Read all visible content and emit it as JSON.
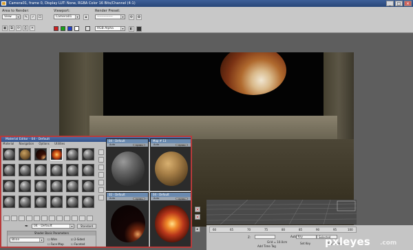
{
  "window": {
    "title": "Camera01, frame 0, Display LUT: None, RGBA Color 16 Bits/Channel (4:1)",
    "minimize": "_",
    "maximize": "□",
    "close": "×"
  },
  "toolbar": {
    "area_label": "Area to Render:",
    "area_value": "View",
    "viewport_label": "Viewport:",
    "viewport_value": "Camera01",
    "preset_label": "Render Preset:",
    "preset_value": "--------------",
    "channel_value": "RGB Alpha",
    "colors": {
      "red": "#cc2020",
      "green": "#18a018",
      "blue": "#2040c8"
    }
  },
  "material_editor": {
    "title": "Material Editor - 04 - Default",
    "menu": [
      "Material",
      "Navigation",
      "Options",
      "Utilities"
    ],
    "material_name": "04 - Default",
    "material_type": "Standard",
    "rollout_title": "Shader Basic Parameters",
    "shader_value": "Blinn",
    "checkboxes": [
      {
        "label": "Wire",
        "checked": false
      },
      {
        "label": "2-Sided",
        "checked": true
      },
      {
        "label": "Face Map",
        "checked": false
      },
      {
        "label": "Faceted",
        "checked": false
      }
    ]
  },
  "previews": [
    {
      "title": "04 - Default",
      "auto": "Auto",
      "update": "Update"
    },
    {
      "title": "Map # 13",
      "auto": "Auto",
      "update": "Update"
    },
    {
      "title": "02 - Default",
      "auto": "Auto",
      "update": "Update"
    },
    {
      "title": "04 - Default",
      "auto": "Auto",
      "update": "Update"
    }
  ],
  "timeline": {
    "ticks": [
      "60",
      "65",
      "70",
      "75",
      "80",
      "85",
      "90",
      "95",
      "100"
    ],
    "z_label": "Z:",
    "grid_value": "Grid = 10.0cm",
    "auto_key": "Auto Key",
    "selected": "Selected",
    "add_time_tag": "Add Time Tag",
    "set_key": "Set Key",
    "key_filters": "Key Filters..."
  },
  "watermark": {
    "brand": "pxleyes",
    "tld": ".com"
  }
}
